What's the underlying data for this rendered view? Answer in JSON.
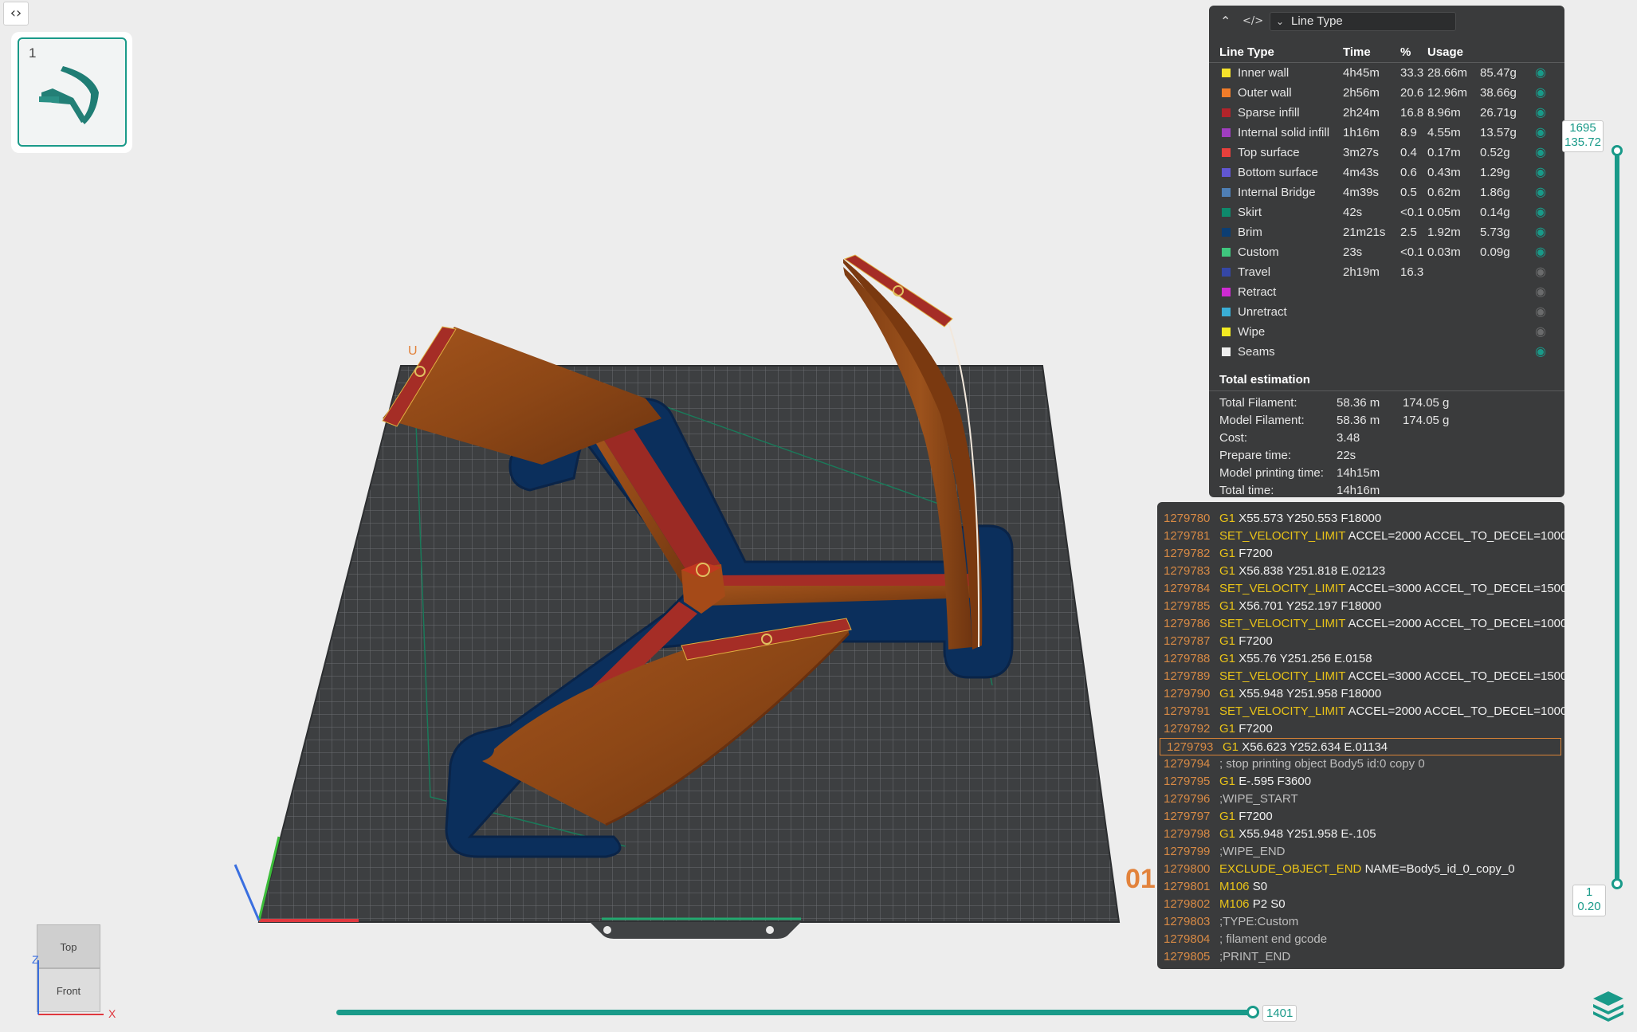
{
  "toolbar": {
    "collapse_icon": "code-chevrons-icon"
  },
  "plate": {
    "index": "1"
  },
  "legend": {
    "dropdown_label": "Line Type",
    "columns": {
      "type": "Line Type",
      "time": "Time",
      "percent": "%",
      "usage": "Usage"
    },
    "rows": [
      {
        "name": "Inner wall",
        "color": "#f5e22b",
        "time": "4h45m",
        "percent": "33.3",
        "length": "28.66m",
        "weight": "85.47g",
        "visible": true
      },
      {
        "name": "Outer wall",
        "color": "#f07c2a",
        "time": "2h56m",
        "percent": "20.6",
        "length": "12.96m",
        "weight": "38.66g",
        "visible": true
      },
      {
        "name": "Sparse infill",
        "color": "#b2242a",
        "time": "2h24m",
        "percent": "16.8",
        "length": "8.96m",
        "weight": "26.71g",
        "visible": true
      },
      {
        "name": "Internal solid infill",
        "color": "#a03ec1",
        "time": "1h16m",
        "percent": "8.9",
        "length": "4.55m",
        "weight": "13.57g",
        "visible": true
      },
      {
        "name": "Top surface",
        "color": "#e8403c",
        "time": "3m27s",
        "percent": "0.4",
        "length": "0.17m",
        "weight": "0.52g",
        "visible": true
      },
      {
        "name": "Bottom surface",
        "color": "#6157d3",
        "time": "4m43s",
        "percent": "0.6",
        "length": "0.43m",
        "weight": "1.29g",
        "visible": true
      },
      {
        "name": "Internal Bridge",
        "color": "#4f7fb5",
        "time": "4m39s",
        "percent": "0.5",
        "length": "0.62m",
        "weight": "1.86g",
        "visible": true
      },
      {
        "name": "Skirt",
        "color": "#0e8a6c",
        "time": "42s",
        "percent": "<0.1",
        "length": "0.05m",
        "weight": "0.14g",
        "visible": true
      },
      {
        "name": "Brim",
        "color": "#0c3e73",
        "time": "21m21s",
        "percent": "2.5",
        "length": "1.92m",
        "weight": "5.73g",
        "visible": true
      },
      {
        "name": "Custom",
        "color": "#3fc77e",
        "time": "23s",
        "percent": "<0.1",
        "length": "0.03m",
        "weight": "0.09g",
        "visible": true
      },
      {
        "name": "Travel",
        "color": "#3547a6",
        "time": "2h19m",
        "percent": "16.3",
        "length": "",
        "weight": "",
        "visible": false
      },
      {
        "name": "Retract",
        "color": "#cf2bd2",
        "time": "",
        "percent": "",
        "length": "",
        "weight": "",
        "visible": false
      },
      {
        "name": "Unretract",
        "color": "#3aaed6",
        "time": "",
        "percent": "",
        "length": "",
        "weight": "",
        "visible": false
      },
      {
        "name": "Wipe",
        "color": "#f2ea22",
        "time": "",
        "percent": "",
        "length": "",
        "weight": "",
        "visible": false
      },
      {
        "name": "Seams",
        "color": "#eeeeee",
        "time": "",
        "percent": "",
        "length": "",
        "weight": "",
        "visible": true
      }
    ]
  },
  "estimation": {
    "title": "Total estimation",
    "rows": [
      {
        "label": "Total Filament:",
        "v1": "58.36 m",
        "v2": "174.05 g"
      },
      {
        "label": "Model Filament:",
        "v1": "58.36 m",
        "v2": "174.05 g"
      },
      {
        "label": "Cost:",
        "v1": "3.48",
        "v2": ""
      },
      {
        "label": "Prepare time:",
        "v1": "22s",
        "v2": ""
      },
      {
        "label": "Model printing time:",
        "v1": "14h15m",
        "v2": ""
      },
      {
        "label": "Total time:",
        "v1": "14h16m",
        "v2": ""
      }
    ]
  },
  "gcode": {
    "current_line": "1279793",
    "lines": [
      {
        "num": "1279780",
        "cmd": "G1",
        "args": "X55.573 Y250.553 F18000",
        "comment": ""
      },
      {
        "num": "1279781",
        "cmd": "SET_VELOCITY_LIMIT",
        "args": "ACCEL=2000 ACCEL_TO_DECEL=1000",
        "comment": ""
      },
      {
        "num": "1279782",
        "cmd": "G1",
        "args": "F7200",
        "comment": ""
      },
      {
        "num": "1279783",
        "cmd": "G1",
        "args": "X56.838 Y251.818 E.02123",
        "comment": ""
      },
      {
        "num": "1279784",
        "cmd": "SET_VELOCITY_LIMIT",
        "args": "ACCEL=3000 ACCEL_TO_DECEL=1500",
        "comment": ""
      },
      {
        "num": "1279785",
        "cmd": "G1",
        "args": "X56.701 Y252.197 F18000",
        "comment": ""
      },
      {
        "num": "1279786",
        "cmd": "SET_VELOCITY_LIMIT",
        "args": "ACCEL=2000 ACCEL_TO_DECEL=1000",
        "comment": ""
      },
      {
        "num": "1279787",
        "cmd": "G1",
        "args": "F7200",
        "comment": ""
      },
      {
        "num": "1279788",
        "cmd": "G1",
        "args": "X55.76 Y251.256 E.0158",
        "comment": ""
      },
      {
        "num": "1279789",
        "cmd": "SET_VELOCITY_LIMIT",
        "args": "ACCEL=3000 ACCEL_TO_DECEL=1500",
        "comment": ""
      },
      {
        "num": "1279790",
        "cmd": "G1",
        "args": "X55.948 Y251.958 F18000",
        "comment": ""
      },
      {
        "num": "1279791",
        "cmd": "SET_VELOCITY_LIMIT",
        "args": "ACCEL=2000 ACCEL_TO_DECEL=1000",
        "comment": ""
      },
      {
        "num": "1279792",
        "cmd": "G1",
        "args": "F7200",
        "comment": ""
      },
      {
        "num": "1279793",
        "cmd": "G1",
        "args": "X56.623 Y252.634 E.01134",
        "comment": ""
      },
      {
        "num": "1279794",
        "cmd": "",
        "args": "",
        "comment": "; stop printing object Body5 id:0 copy 0"
      },
      {
        "num": "1279795",
        "cmd": "G1",
        "args": "E-.595 F3600",
        "comment": ""
      },
      {
        "num": "1279796",
        "cmd": "",
        "args": "",
        "comment": ";WIPE_START"
      },
      {
        "num": "1279797",
        "cmd": "G1",
        "args": "F7200",
        "comment": ""
      },
      {
        "num": "1279798",
        "cmd": "G1",
        "args": "X55.948 Y251.958 E-.105",
        "comment": ""
      },
      {
        "num": "1279799",
        "cmd": "",
        "args": "",
        "comment": ";WIPE_END"
      },
      {
        "num": "1279800",
        "cmd": "EXCLUDE_OBJECT_END",
        "args": "NAME=Body5_id_0_copy_0",
        "comment": ""
      },
      {
        "num": "1279801",
        "cmd": "M106",
        "args": "S0",
        "comment": ""
      },
      {
        "num": "1279802",
        "cmd": "M106",
        "args": "P2 S0",
        "comment": ""
      },
      {
        "num": "1279803",
        "cmd": "",
        "args": "",
        "comment": ";TYPE:Custom"
      },
      {
        "num": "1279804",
        "cmd": "",
        "args": "",
        "comment": "; filament end gcode"
      },
      {
        "num": "1279805",
        "cmd": "",
        "args": "",
        "comment": ";PRINT_END"
      }
    ]
  },
  "layer_slider": {
    "top_layer": "1695",
    "top_height": "135.72",
    "bottom_layer": "1",
    "bottom_height": "0.20"
  },
  "move_slider": {
    "value": "1401",
    "fraction": 1.0
  },
  "view_cube": {
    "top": "Top",
    "front": "Front",
    "axis_x": "X",
    "axis_z": "Z"
  },
  "overlay_number": "01",
  "model_label_fragment": "U",
  "colors": {
    "accent": "#199a89",
    "panel": "#3a3b3c",
    "bed": "#3d3f41",
    "part": "#8a4416",
    "brim": "#0c3463"
  }
}
